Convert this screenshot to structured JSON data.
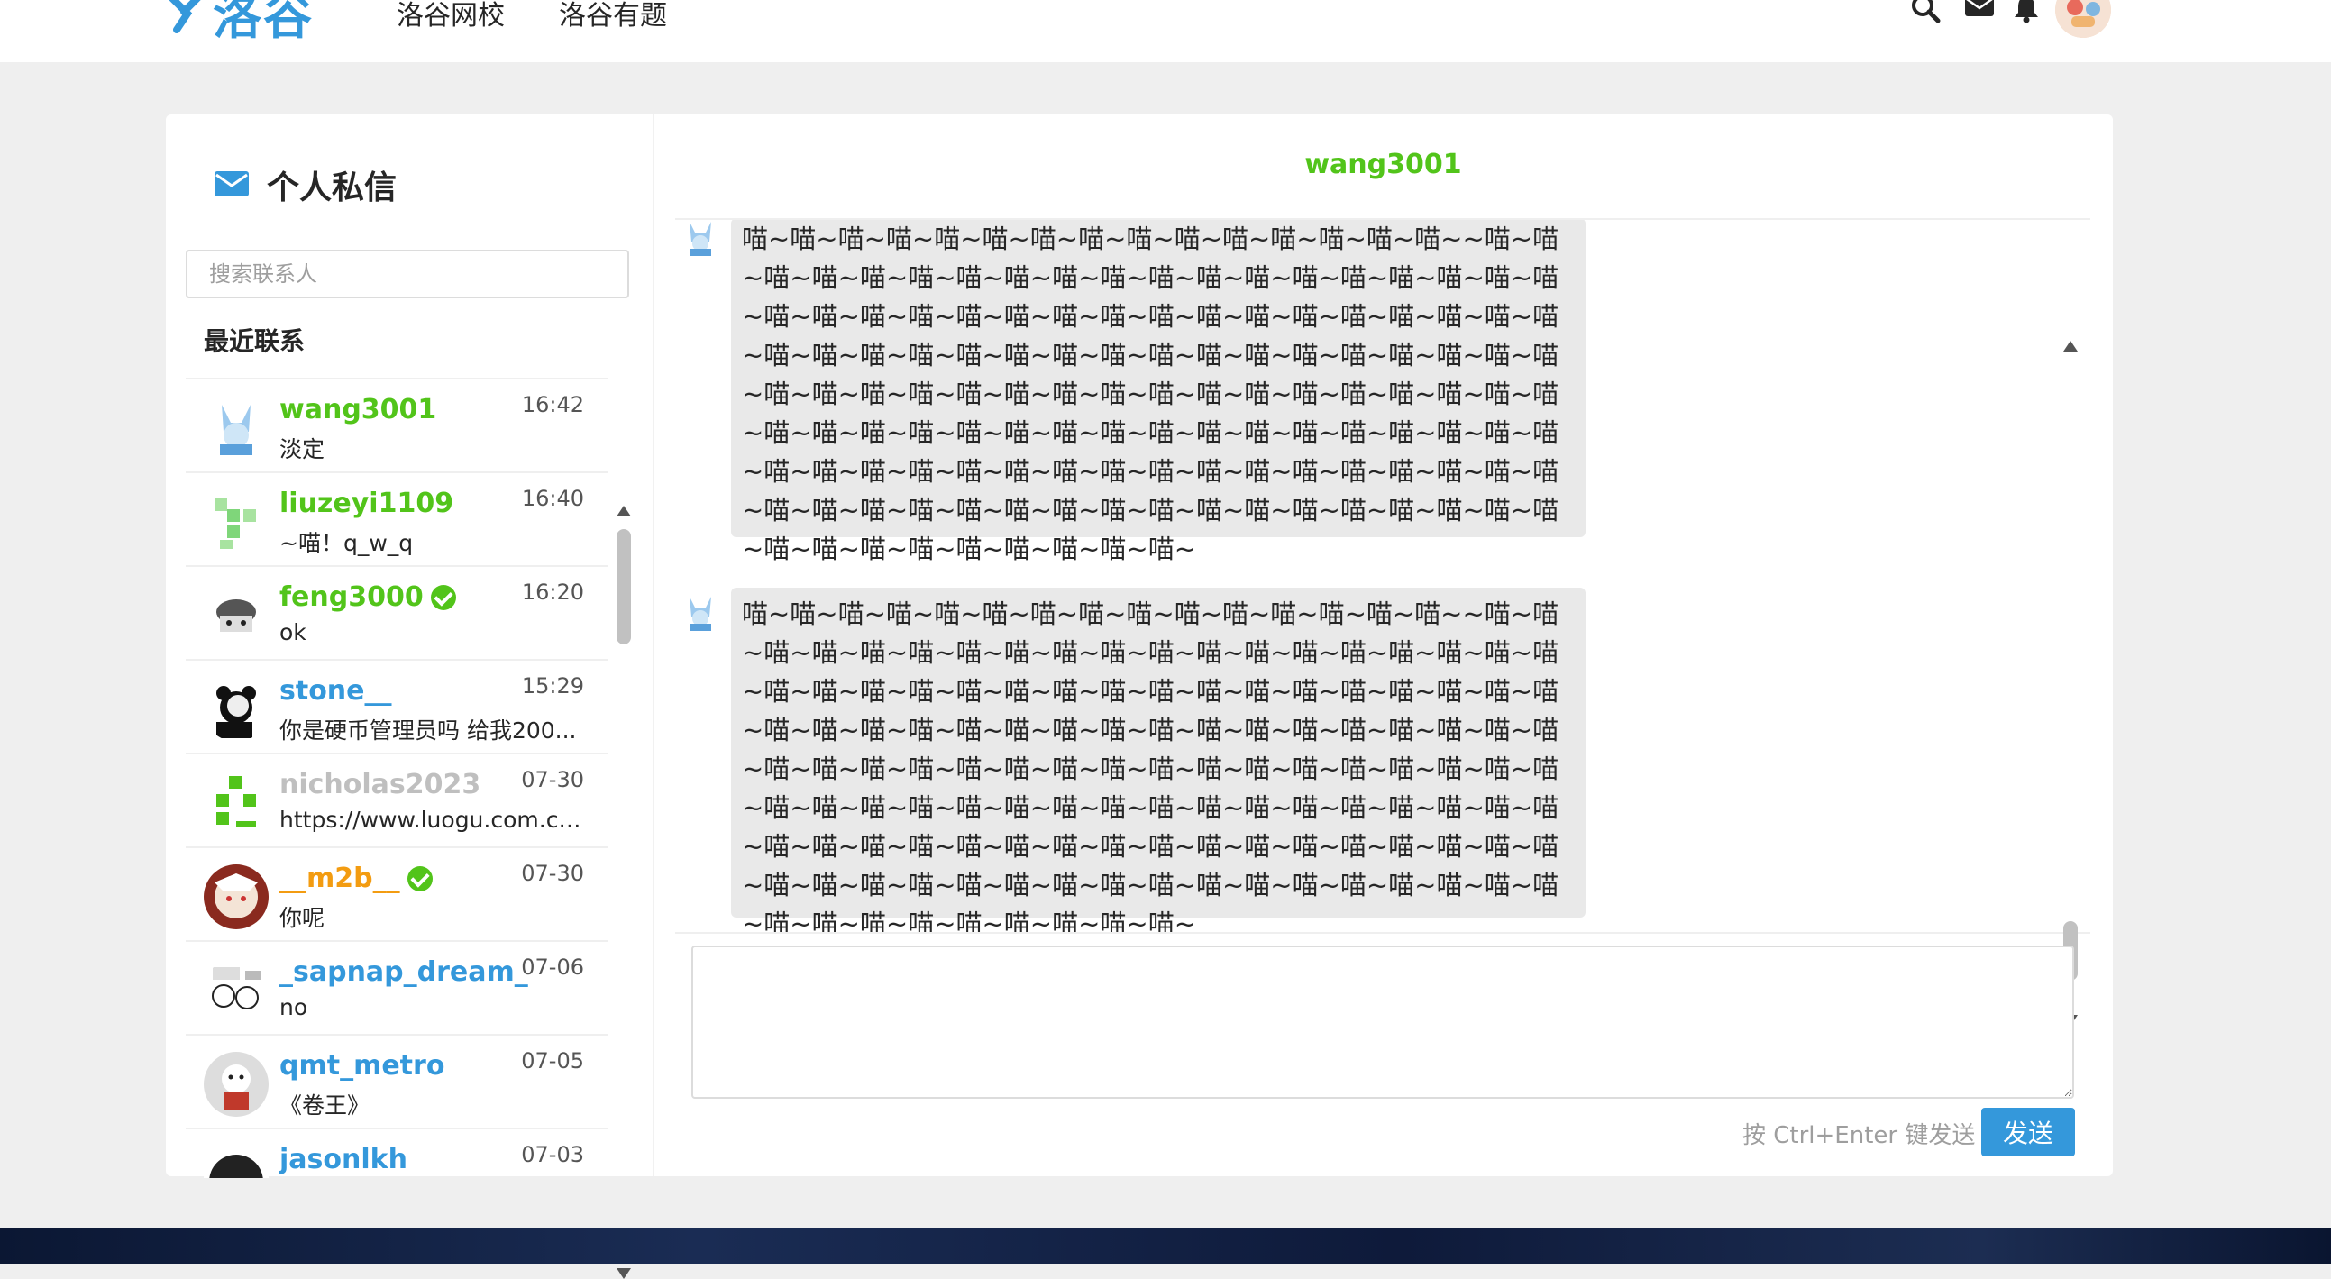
{
  "header": {
    "logo_text": "洛谷",
    "nav": [
      "洛谷网校",
      "洛谷有题"
    ]
  },
  "messages_panel": {
    "title": "个人私信",
    "search_placeholder": "搜索联系人",
    "recent_label": "最近联系",
    "contacts": [
      {
        "name": "wang3001",
        "time": "16:42",
        "last": "淡定",
        "color": "#52c41a",
        "verified": false
      },
      {
        "name": "liuzeyi1109",
        "time": "16:40",
        "last": "~喵！q_w_q",
        "color": "#52c41a",
        "verified": false
      },
      {
        "name": "feng3000",
        "time": "16:20",
        "last": "ok",
        "color": "#52c41a",
        "verified": true
      },
      {
        "name": "stone__",
        "time": "15:29",
        "last": "你是硬币管理员吗 给我200...",
        "color": "#3498db",
        "verified": false
      },
      {
        "name": "nicholas2023",
        "time": "07-30",
        "last": "https://www.luogu.com.cn...",
        "color": "#bfbfbf",
        "verified": false
      },
      {
        "name": "__m2b__",
        "time": "07-30",
        "last": "你呢",
        "color": "#f39c11",
        "verified": true
      },
      {
        "name": "_sapnap_dream_",
        "time": "07-06",
        "last": "no",
        "color": "#3498db",
        "verified": false
      },
      {
        "name": "qmt_metro",
        "time": "07-05",
        "last": "《卷王》",
        "color": "#3498db",
        "verified": false
      },
      {
        "name": "jasonlkh",
        "time": "07-03",
        "last": "",
        "color": "#3498db",
        "verified": false
      }
    ]
  },
  "chat": {
    "partner": "wang3001",
    "messages": [
      "喵~喵~喵~喵~喵~喵~喵~喵~喵~喵~喵~喵~喵~喵~喵~~喵~喵~喵~喵~喵~喵~喵~喵~喵~喵~喵~喵~喵~喵~喵~喵~喵~喵~喵~喵~喵~喵~喵~喵~喵~喵~喵~喵~喵~喵~喵~喵~喵~喵~喵~喵~喵~喵~喵~喵~喵~喵~喵~喵~喵~喵~喵~喵~喵~喵~喵~喵~喵~喵~喵~喵~喵~喵~喵~喵~喵~喵~喵~喵~喵~喵~喵~喵~喵~喵~喵~喵~喵~喵~喵~喵~喵~喵~喵~喵~喵~喵~喵~喵~喵~喵~喵~喵~喵~喵~喵~喵~喵~喵~喵~喵~喵~喵~喵~喵~喵~喵~喵~喵~喵~喵~喵~喵~喵~喵~喵~喵~喵~喵~喵~喵~喵~喵~喵~喵~喵~喵~喵~喵~喵~喵~喵~喵~喵~喵~",
      "喵~喵~喵~喵~喵~喵~喵~喵~喵~喵~喵~喵~喵~喵~喵~~喵~喵~喵~喵~喵~喵~喵~喵~喵~喵~喵~喵~喵~喵~喵~喵~喵~喵~喵~喵~喵~喵~喵~喵~喵~喵~喵~喵~喵~喵~喵~喵~喵~喵~喵~喵~喵~喵~喵~喵~喵~喵~喵~喵~喵~喵~喵~喵~喵~喵~喵~喵~喵~喵~喵~喵~喵~喵~喵~喵~喵~喵~喵~喵~喵~喵~喵~喵~喵~喵~喵~喵~喵~喵~喵~喵~喵~喵~喵~喵~喵~喵~喵~喵~喵~喵~喵~喵~喵~喵~喵~喵~喵~喵~喵~喵~喵~喵~喵~喵~喵~喵~喵~喵~喵~喵~喵~喵~喵~喵~喵~喵~喵~喵~喵~喵~喵~喵~喵~喵~喵~喵~喵~喵~喵~喵~喵~喵~喵~喵~"
    ],
    "send_hint": "按 Ctrl+Enter 键发送",
    "send_label": "发送"
  },
  "colors": {
    "accent": "#3498db",
    "green_user": "#52c41a",
    "orange_user": "#f39c11"
  }
}
